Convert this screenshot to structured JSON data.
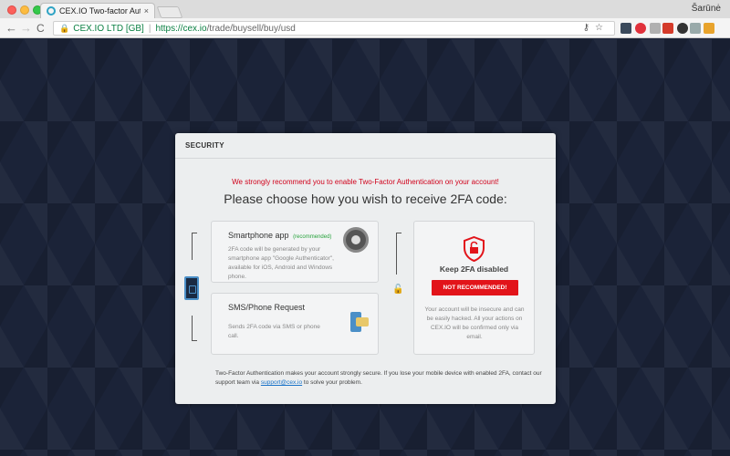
{
  "browser": {
    "tab_title": "CEX.IO Two-factor Authenticatio",
    "tab_close": "×",
    "profile_name": "Šarūnė",
    "site_identity": "CEX.IO LTD [GB]",
    "url_host": "https://cex.io",
    "url_path": "/trade/buysell/buy/usd",
    "back": "←",
    "forward": "→",
    "reload": "C",
    "menu": "⋮",
    "icons": [
      "key-icon",
      "star-icon"
    ]
  },
  "card": {
    "header": "SECURITY",
    "warning": "We strongly recommend you to enable Two-Factor Authentication on your account!",
    "heading": "Please choose how you wish to receive 2FA code:",
    "smartphone": {
      "title": "Smartphone app",
      "badge": "(recommended)",
      "description": "2FA code will be generated by your smartphone app \"Google Authenticator\", available for iOS, Android and Windows phone."
    },
    "sms": {
      "title": "SMS/Phone Request",
      "description": "Sends 2FA code via SMS or phone call."
    },
    "keep_disabled": {
      "title": "Keep 2FA disabled",
      "button": "NOT RECOMMENDED!",
      "description": "Your account will be insecure and can be easily hacked. All your actions on CEX.IO will be confirmed only via email."
    },
    "footer": {
      "before": "Two-Factor Authentication makes your account strongly secure. If you lose your mobile device with enabled 2FA, contact our support team via ",
      "email": "support@cex.io",
      "after": " to solve your problem."
    }
  },
  "colors": {
    "page_bg": "#1b2338",
    "warning": "#d0021b",
    "button_red": "#e2141a",
    "recommended_green": "#27a23c",
    "link_blue": "#1a73c8"
  }
}
